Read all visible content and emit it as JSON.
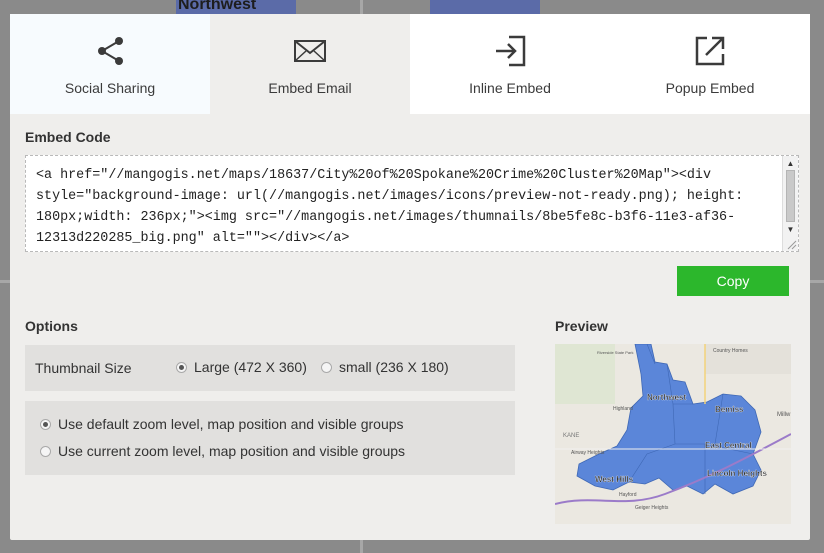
{
  "background": {
    "map_label": "Northwest"
  },
  "tabs": [
    {
      "label": "Social Sharing",
      "icon": "share-icon"
    },
    {
      "label": "Embed Email",
      "icon": "envelope-icon"
    },
    {
      "label": "Inline Embed",
      "icon": "inline-embed-icon"
    },
    {
      "label": "Popup Embed",
      "icon": "popup-embed-icon"
    }
  ],
  "active_tab": "Embed Email",
  "embed_code": {
    "title": "Embed Code",
    "lines": [
      "<a href=\"//mangogis.net/maps/18637/City%20of%20Spokane%20Crime%20Cluster%20Map\"><div",
      "style=\"background-image: url(//mangogis.net/images/icons/preview-not-ready.png); height:",
      "180px;width: 236px;\"><img src=\"//mangogis.net/images/thumnails/8be5fe8c-b3f6-11e3-af36-",
      "12313d220285_big.png\" alt=\"\"></div></a>"
    ]
  },
  "copy_label": "Copy",
  "options": {
    "title": "Options",
    "thumbnail_label": "Thumbnail Size",
    "thumbnail_sizes": [
      {
        "label": "Large (472 X 360)",
        "checked": true
      },
      {
        "label": "small (236 X 180)",
        "checked": false
      }
    ],
    "zoom_choices": [
      {
        "label": "Use default zoom level, map position and visible groups",
        "checked": true
      },
      {
        "label": "Use current zoom level, map position and visible groups",
        "checked": false
      }
    ]
  },
  "preview": {
    "title": "Preview",
    "map_labels": {
      "northwest": "Northwest",
      "bemiss": "Bemiss",
      "east_central": "East Central",
      "west_hills": "West Hills",
      "lincoln_heights": "Lincoln Heights",
      "highland": "Highland",
      "airway_heights": "Airway Heights",
      "millwood": "Millw",
      "country_homes": "Country Homes",
      "riverside": "Riverside State Park",
      "kane": "KANE",
      "hayford": "Hayford",
      "geiger": "Geiger Heights"
    }
  },
  "colors": {
    "accent": "#2cb72c",
    "map_fill": "#5b86d9"
  }
}
